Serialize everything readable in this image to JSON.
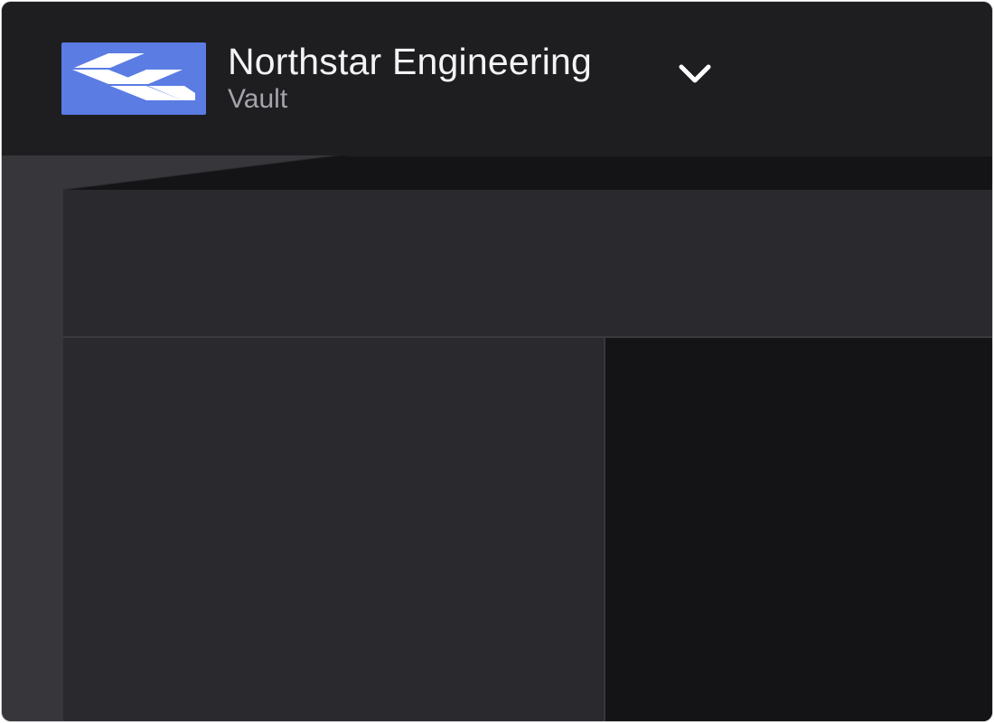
{
  "workspace": {
    "name": "Northstar Engineering",
    "product": "Vault",
    "logo_color": "#5a7ce3",
    "switcher_icon": "chevron-down-icon"
  },
  "colors": {
    "header_bg": "#1e1e21",
    "frame_bg": "#37363a",
    "panel_bg": "#2a292d",
    "content_bg": "#141316",
    "title_text": "#f3f3f5",
    "subtitle_text": "#a4a4aa"
  }
}
